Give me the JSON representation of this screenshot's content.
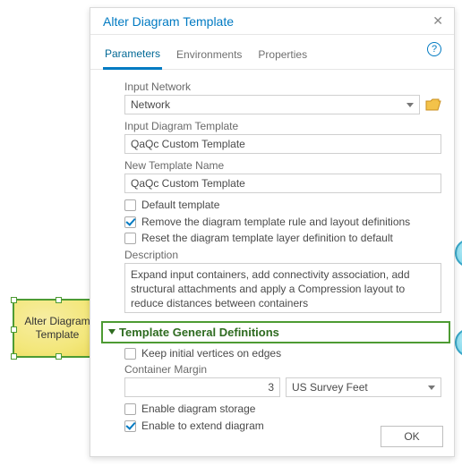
{
  "node": {
    "label": "Alter Diagram Template"
  },
  "dialog": {
    "title": "Alter Diagram Template",
    "tabs": {
      "parameters": "Parameters",
      "environments": "Environments",
      "properties": "Properties"
    },
    "input_network_label": "Input Network",
    "input_network_value": "Network",
    "input_diagram_template_label": "Input Diagram Template",
    "input_diagram_template_value": "QaQc Custom Template",
    "new_template_name_label": "New Template Name",
    "new_template_name_value": "QaQc Custom Template",
    "default_template_label": "Default template",
    "remove_defs_label": "Remove the diagram template rule and layout definitions",
    "reset_layer_label": "Reset the diagram template layer definition to default",
    "description_label": "Description",
    "description_value": "Expand input containers, add connectivity association, add structural attachments and apply a Compression layout to reduce distances between containers",
    "section_header": "Template General Definitions",
    "keep_vertices_label": "Keep initial vertices on edges",
    "container_margin_label": "Container Margin",
    "container_margin_value": "3",
    "container_margin_unit": "US Survey Feet",
    "enable_storage_label": "Enable diagram storage",
    "enable_extend_label": "Enable to extend diagram",
    "ok": "OK"
  }
}
